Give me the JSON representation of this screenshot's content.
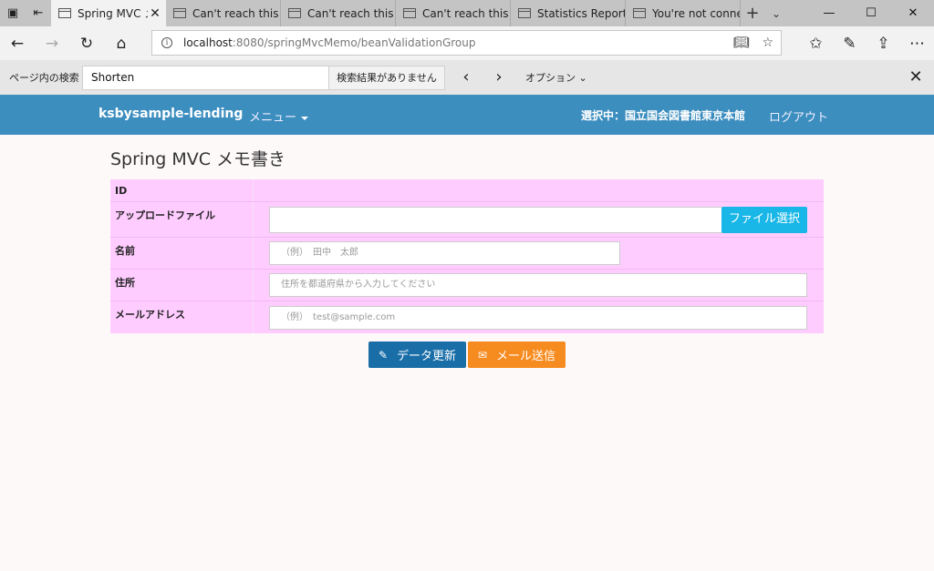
{
  "tabs": [
    {
      "label": "Spring MVC メ",
      "active": true
    },
    {
      "label": "Can't reach this pa",
      "active": false
    },
    {
      "label": "Can't reach this pa",
      "active": false
    },
    {
      "label": "Can't reach this pa",
      "active": false
    },
    {
      "label": "Statistics Report fo",
      "active": false
    },
    {
      "label": "You're not connec",
      "active": false
    }
  ],
  "address": {
    "host": "localhost",
    "path": ":8080/springMvcMemo/beanValidationGroup"
  },
  "findbar": {
    "label": "ページ内の検索",
    "query": "Shorten",
    "result": "検索結果がありません",
    "options": "オプション"
  },
  "appnav": {
    "brand": "ksbysample-lending",
    "menu": "メニュー",
    "selected": "選択中：国立国会図書館東京本館",
    "logout": "ログアウト"
  },
  "page": {
    "title": "Spring MVC メモ書き"
  },
  "form": {
    "id_label": "ID",
    "upload_label": "アップロードファイル",
    "file_button": "ファイル選択",
    "name_label": "名前",
    "name_placeholder": "（例）　田中　太郎",
    "address_label": "住所",
    "address_placeholder": "住所を都道府県から入力してください",
    "email_label": "メールアドレス",
    "email_placeholder": "（例）　test@sample.com"
  },
  "buttons": {
    "update": "データ更新",
    "mail": "メール送信"
  },
  "colors": {
    "navbar": "#3c8ebf",
    "form_bg": "#ffccff",
    "file_button": "#19b7e7",
    "update_button": "#1a6ea8",
    "mail_button": "#f68b1f"
  }
}
